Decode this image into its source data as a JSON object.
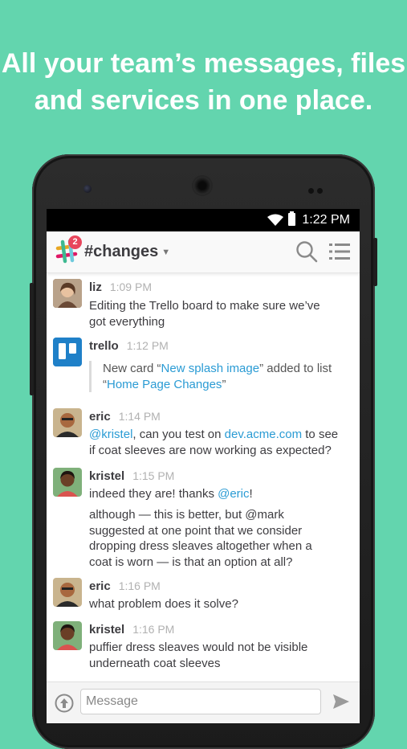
{
  "headline": {
    "line1": "All your team’s messages, files",
    "line2": "and services in one place."
  },
  "status_bar": {
    "time": "1:22 PM"
  },
  "app_bar": {
    "channel_name": "#changes",
    "badge_count": "2",
    "icons": [
      "slack-logo-icon",
      "search-icon",
      "channel-menu-icon"
    ]
  },
  "messages": [
    {
      "author": "liz",
      "time": "1:09 PM",
      "lines": [
        "Editing the Trello board to make sure we’ve",
        "got everything"
      ]
    },
    {
      "author": "trello",
      "time": "1:12 PM",
      "attachment": {
        "prefix": "New card “",
        "card": "New splash image",
        "mid": "” added to list",
        "open": "“",
        "list": "Home Page Changes",
        "close": "”"
      }
    },
    {
      "author": "eric",
      "time": "1:14 PM",
      "mention": "@kristel",
      "text1": ", can you test on ",
      "url": "dev.acme.com",
      "text2": " to see",
      "line2": "if coat sleeves are now working as expected?"
    },
    {
      "author": "kristel",
      "time": "1:15 PM",
      "text1": "indeed they are! thanks ",
      "mention": "@eric",
      "text2": "!",
      "lines": [
        "although — this is better, but @mark",
        "suggested at one point that we consider",
        "dropping dress sleaves altogether when a",
        "coat is worn — is that an option at all?"
      ]
    },
    {
      "author": "eric",
      "time": "1:16 PM",
      "lines": [
        "what problem does it solve?"
      ]
    },
    {
      "author": "kristel",
      "time": "1:16 PM",
      "lines": [
        "puffier dress sleaves would not be visible",
        "underneath coat sleeves"
      ]
    }
  ],
  "composer": {
    "placeholder": "Message"
  },
  "colors": {
    "background": "#63d5ae",
    "link": "#2a9bd4",
    "badge": "#e8465c"
  }
}
